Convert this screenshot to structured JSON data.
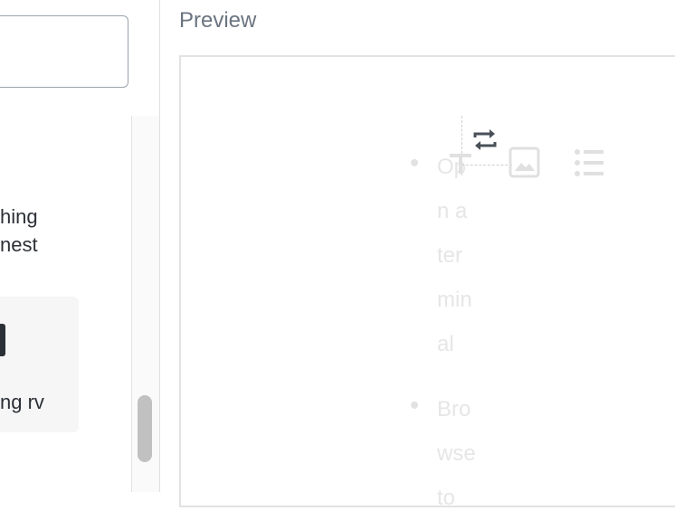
{
  "left": {
    "item_text_lines": [
      "hing",
      "nest"
    ],
    "card_label": "ng rv"
  },
  "preview": {
    "title": "Preview",
    "list_items": [
      [
        "Op",
        "n a",
        "ter",
        "min",
        "al"
      ],
      [
        "Bro",
        "wse",
        "to"
      ]
    ]
  },
  "toolbar": {
    "icons": [
      "swap-icon",
      "text-icon",
      "image-icon",
      "list-icon"
    ]
  },
  "colors": {
    "title": "#6b7480",
    "ghost_text": "#e6e6e6",
    "icon_dark": "#4a5058",
    "icon_light": "#e0e0e0"
  }
}
